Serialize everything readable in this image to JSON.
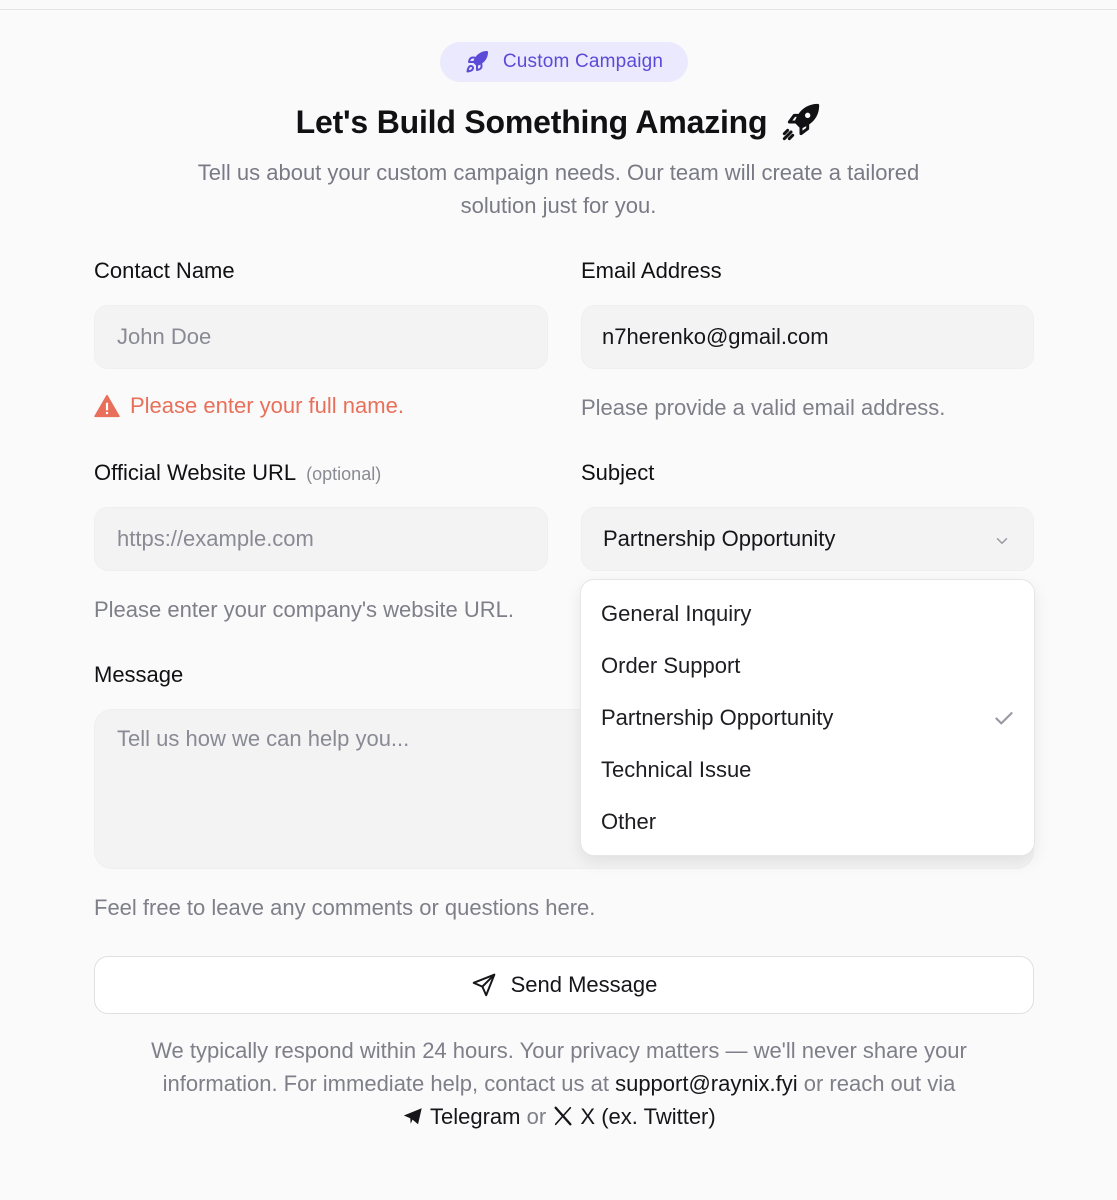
{
  "badge": {
    "label": "Custom Campaign",
    "icon": "rocket-icon"
  },
  "header": {
    "title": "Let's Build Something Amazing",
    "subtitle": "Tell us about your custom campaign needs. Our team will create a tailored solution just for you."
  },
  "form": {
    "contact_name": {
      "label": "Contact Name",
      "placeholder": "John Doe",
      "error": "Please enter your full name."
    },
    "email": {
      "label": "Email Address",
      "value": "n7herenko@gmail.com",
      "help": "Please provide a valid email address."
    },
    "website": {
      "label": "Official Website URL",
      "optional": "(optional)",
      "placeholder": "https://example.com",
      "help": "Please enter your company's website URL."
    },
    "subject": {
      "label": "Subject",
      "selected": "Partnership Opportunity",
      "options": [
        "General Inquiry",
        "Order Support",
        "Partnership Opportunity",
        "Technical Issue",
        "Other"
      ]
    },
    "message": {
      "label": "Message",
      "placeholder": "Tell us how we can help you...",
      "help": "Feel free to leave any comments or questions here."
    },
    "send_label": "Send Message"
  },
  "footer": {
    "text1": "We typically respond within 24 hours. Your privacy matters — we'll never share your information. For immediate help, contact us at",
    "email": "support@raynix.fyi",
    "text2": "or reach out via",
    "telegram": "Telegram",
    "or": "or",
    "twitter": "X (ex. Twitter)"
  },
  "colors": {
    "accent": "#5b4bd6",
    "accent_bg": "#ebe9fd",
    "error": "#e8705a"
  }
}
